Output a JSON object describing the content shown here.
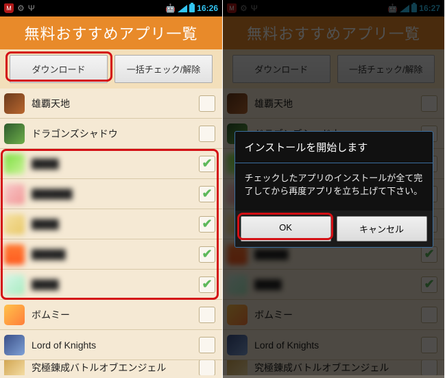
{
  "status": {
    "shield": "M",
    "time_left": "16:26",
    "time_right": "16:27"
  },
  "header": {
    "title": "無料おすすめアプリ一覧"
  },
  "buttons": {
    "download": "ダウンロード",
    "toggle_all": "一括チェック/解除"
  },
  "apps": [
    {
      "name": "雄覇天地",
      "checked": false,
      "icon": "linear-gradient(135deg,#6b3a1c,#b9672f)"
    },
    {
      "name": "ドラゴンズシャドウ",
      "checked": false,
      "icon": "linear-gradient(135deg,#2c5a2c,#6fae4a)"
    },
    {
      "name": "████",
      "checked": true,
      "icon": "linear-gradient(135deg,#7adf3f,#cdf29b)",
      "blur": true
    },
    {
      "name": "██████",
      "checked": true,
      "icon": "linear-gradient(135deg,#f7c9c9,#f29797)",
      "blur": true
    },
    {
      "name": "████",
      "checked": true,
      "icon": "linear-gradient(135deg,#f5e0a3,#e8c867)",
      "blur": true
    },
    {
      "name": "█████",
      "checked": true,
      "icon": "linear-gradient(180deg,#ff7a33,#ff5a1e)",
      "blur": true
    },
    {
      "name": "████",
      "checked": true,
      "icon": "linear-gradient(135deg,#d8f5e8,#a7ecc0)",
      "blur": true
    },
    {
      "name": "ボムミー",
      "checked": false,
      "icon": "linear-gradient(135deg,#ffc24a,#ff7e3b)"
    },
    {
      "name": "Lord of Knights",
      "checked": false,
      "icon": "linear-gradient(135deg,#3a4f87,#7fa1d6)"
    },
    {
      "name": "究極錬成バトルオブエンジェル",
      "checked": false,
      "icon": "linear-gradient(135deg,#cfa24d,#f6e0a9)"
    }
  ],
  "dialog": {
    "title": "インストールを開始します",
    "body": "チェックしたアプリのインストールが全て完了してから再度アプリを立ち上げて下さい。",
    "ok": "OK",
    "cancel": "キャンセル"
  }
}
